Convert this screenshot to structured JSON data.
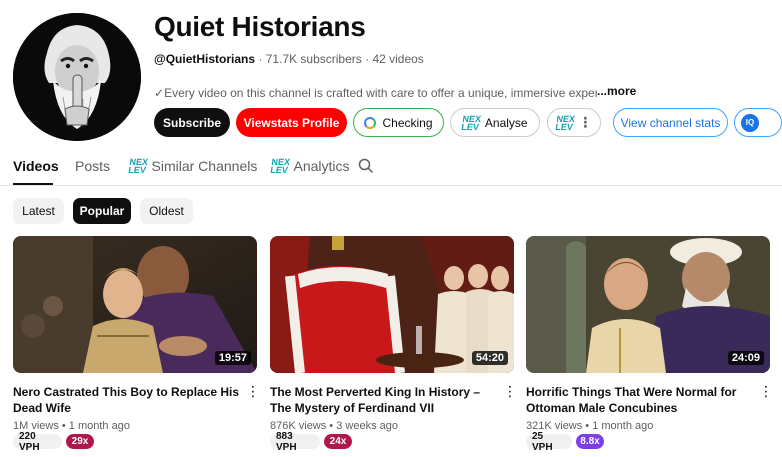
{
  "channel": {
    "title": "Quiet Historians",
    "handle": "@QuietHistorians",
    "stats": " · 71.7K subscribers · 42 videos",
    "description": "Every video on this channel is crafted with care to offer a unique, immersive experie",
    "more": "...more"
  },
  "buttons": {
    "subscribe": "Subscribe",
    "viewstats": "Viewstats Profile",
    "checking": "Checking",
    "analyse": "Analyse",
    "view_stats": "View channel stats",
    "circle_badge": "IQ"
  },
  "tabs": {
    "videos": "Videos",
    "posts": "Posts",
    "similar": "Similar Channels",
    "analytics": "Analytics"
  },
  "chips": {
    "latest": "Latest",
    "popular": "Popular",
    "oldest": "Oldest"
  },
  "videos": [
    {
      "title": "Nero Castrated This Boy to Replace His Dead Wife",
      "duration": "19:57",
      "meta": "1M views • 1 month ago",
      "vph": "220 VPH",
      "multiplier": "29x",
      "multiplier_color": "#b0184a"
    },
    {
      "title": "The Most Perverted King In History – The Mystery of Ferdinand VII",
      "duration": "54:20",
      "meta": "876K views • 3 weeks ago",
      "vph": "883 VPH",
      "multiplier": "24x",
      "multiplier_color": "#b0184a"
    },
    {
      "title": "Horrific Things That Were Normal for Ottoman Male Concubines",
      "duration": "24:09",
      "meta": "321K views • 1 month ago",
      "vph": "25 VPH",
      "multiplier": "8.8x",
      "multiplier_color": "#7b3fe4"
    }
  ],
  "icons": {
    "checkmark": "check-icon",
    "spinner": "loading-spinner-icon",
    "nexlev": "nexlev-logo-icon",
    "search": "search-icon",
    "more": "more-vert-icon"
  },
  "colors": {
    "subscribe_bg": "#0f0f0f",
    "viewstats_bg": "#ff0000",
    "link_blue": "#1a73e8"
  }
}
